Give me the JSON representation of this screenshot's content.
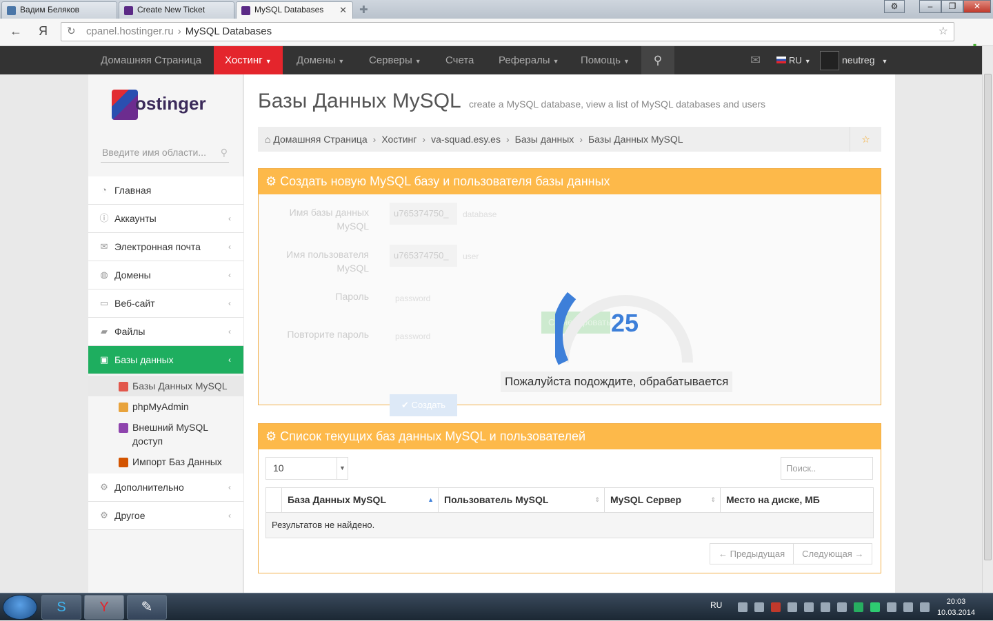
{
  "browser": {
    "tabs": [
      {
        "label": "Вадим Беляков",
        "active": false
      },
      {
        "label": "Create New Ticket",
        "active": false
      },
      {
        "label": "MySQL Databases",
        "active": true
      }
    ],
    "url_host": "cpanel.hostinger.ru",
    "url_sep": "›",
    "url_title": "MySQL Databases",
    "yandex_glyph": "Я"
  },
  "topnav": {
    "items": [
      "Домашняя Страница",
      "Хостинг",
      "Домены",
      "Серверы",
      "Счета",
      "Рефералы",
      "Помощь"
    ],
    "lang": "RU",
    "user": "neutreg"
  },
  "sidebar": {
    "logo_text": "ostinger",
    "search_placeholder": "Введите имя области...",
    "menu": [
      {
        "label": "Главная",
        "icon": "dashboard-icon"
      },
      {
        "label": "Аккаунты",
        "icon": "info-icon"
      },
      {
        "label": "Электронная почта",
        "icon": "envelope-icon"
      },
      {
        "label": "Домены",
        "icon": "globe-icon"
      },
      {
        "label": "Веб-сайт",
        "icon": "monitor-icon"
      },
      {
        "label": "Файлы",
        "icon": "folder-icon"
      },
      {
        "label": "Базы данных",
        "icon": "database-icon",
        "active": true
      }
    ],
    "submenu": [
      "Базы Данных MySQL",
      "phpMyAdmin",
      "Внешний MySQL доступ",
      "Импорт Баз Данных"
    ],
    "menu_after": [
      {
        "label": "Дополнительно",
        "icon": "cogs-icon"
      },
      {
        "label": "Другое",
        "icon": "gear-icon"
      }
    ]
  },
  "page": {
    "title": "Базы Данных MySQL",
    "subtitle": "create a MySQL database, view a list of MySQL databases and users",
    "breadcrumb": [
      "Домашняя Страница",
      "Хостинг",
      "va-squad.esy.es",
      "Базы данных",
      "Базы Данных MySQL"
    ]
  },
  "create_panel": {
    "heading": "Создать новую MySQL базу и пользователя базы данных",
    "db_label": "Имя базы данных MySQL",
    "db_prefix": "u765374750_",
    "db_placeholder": "database",
    "user_label": "Имя пользователя MySQL",
    "user_prefix": "u765374750_",
    "user_placeholder": "user",
    "pass_label": "Пароль",
    "pass_placeholder": "password",
    "pass2_label": "Повторите пароль",
    "pass2_placeholder": "password",
    "generate_label": "Сгенерировать",
    "create_label": "Создать",
    "progress_value": "25",
    "progress_fraction": 0.25,
    "wait_text": "Пожалуйста подождите, обрабатывается"
  },
  "list_panel": {
    "heading": "Список текущих баз данных MySQL и пользователей",
    "page_size": "10",
    "search_placeholder": "Поиск..",
    "columns": [
      "База Данных MySQL",
      "Пользователь MySQL",
      "MySQL Сервер",
      "Место на диске, МБ"
    ],
    "empty_text": "Результатов не найдено.",
    "prev": "← Предыдущая",
    "next": "Следующая →"
  },
  "taskbar": {
    "lang": "RU",
    "time": "20:03",
    "date": "10.03.2014"
  },
  "colors": {
    "accent_red": "#e4252c",
    "active_green": "#1eae5f",
    "panel_orange": "#fdb94a",
    "progress_blue": "#3d7fd9"
  }
}
